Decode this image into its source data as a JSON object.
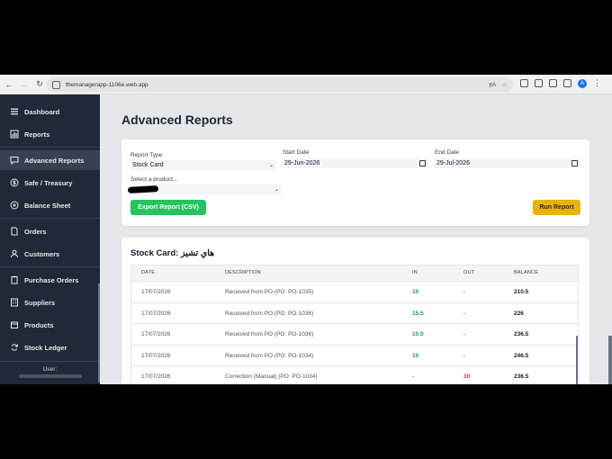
{
  "browser": {
    "url": "themanagerapp-1106e.web.app",
    "zoom_icon": "translate-icon",
    "avatar_letter": "A"
  },
  "sidebar": {
    "items": [
      {
        "label": "Dashboard",
        "icon": "menu-icon"
      },
      {
        "label": "Reports",
        "icon": "chart-icon"
      },
      {
        "label": "Advanced Reports",
        "icon": "chat-icon",
        "active": true
      },
      {
        "label": "Safe / Treasury",
        "icon": "dollar-icon"
      },
      {
        "label": "Balance Sheet",
        "icon": "scale-icon"
      },
      {
        "label": "Orders",
        "icon": "document-icon"
      },
      {
        "label": "Customers",
        "icon": "person-icon"
      },
      {
        "label": "Purchase Orders",
        "icon": "clipboard-icon"
      },
      {
        "label": "Suppliers",
        "icon": "building-icon"
      },
      {
        "label": "Products",
        "icon": "box-icon"
      },
      {
        "label": "Stock Ledger",
        "icon": "refresh-icon"
      }
    ],
    "user_label": "User:"
  },
  "main": {
    "title": "Advanced Reports",
    "form": {
      "report_type_label": "Report Type",
      "report_type_value": "Stock Card",
      "start_date_label": "Start Date",
      "start_date_value": "29-Jun-2026",
      "end_date_label": "End Date",
      "end_date_value": "29-Jul-2026",
      "product_label": "Select a product...",
      "export_label": "Export Report (CSV)",
      "run_label": "Run Report"
    },
    "result": {
      "title": "Stock Card: هاي تشيز",
      "columns": [
        "DATE",
        "DESCRIPTION",
        "IN",
        "OUT",
        "BALANCE"
      ],
      "rows": [
        {
          "date": "17/07/2026",
          "desc": "Received from PO (PO: PO-1035)",
          "in": "10",
          "out": "-",
          "balance": "210.5"
        },
        {
          "date": "17/07/2026",
          "desc": "Received from PO (PO: PO-1036)",
          "in": "15.5",
          "out": "-",
          "balance": "226"
        },
        {
          "date": "17/07/2026",
          "desc": "Received from PO (PO: PO-1036)",
          "in": "10.5",
          "out": "-",
          "balance": "236.5"
        },
        {
          "date": "17/07/2026",
          "desc": "Received from PO (PO: PO-1034)",
          "in": "10",
          "out": "-",
          "balance": "246.5"
        },
        {
          "date": "17/07/2026",
          "desc": "Correction (Manual) (PO: PO-1034)",
          "in": "-",
          "out": "10",
          "balance": "236.5"
        }
      ]
    }
  }
}
